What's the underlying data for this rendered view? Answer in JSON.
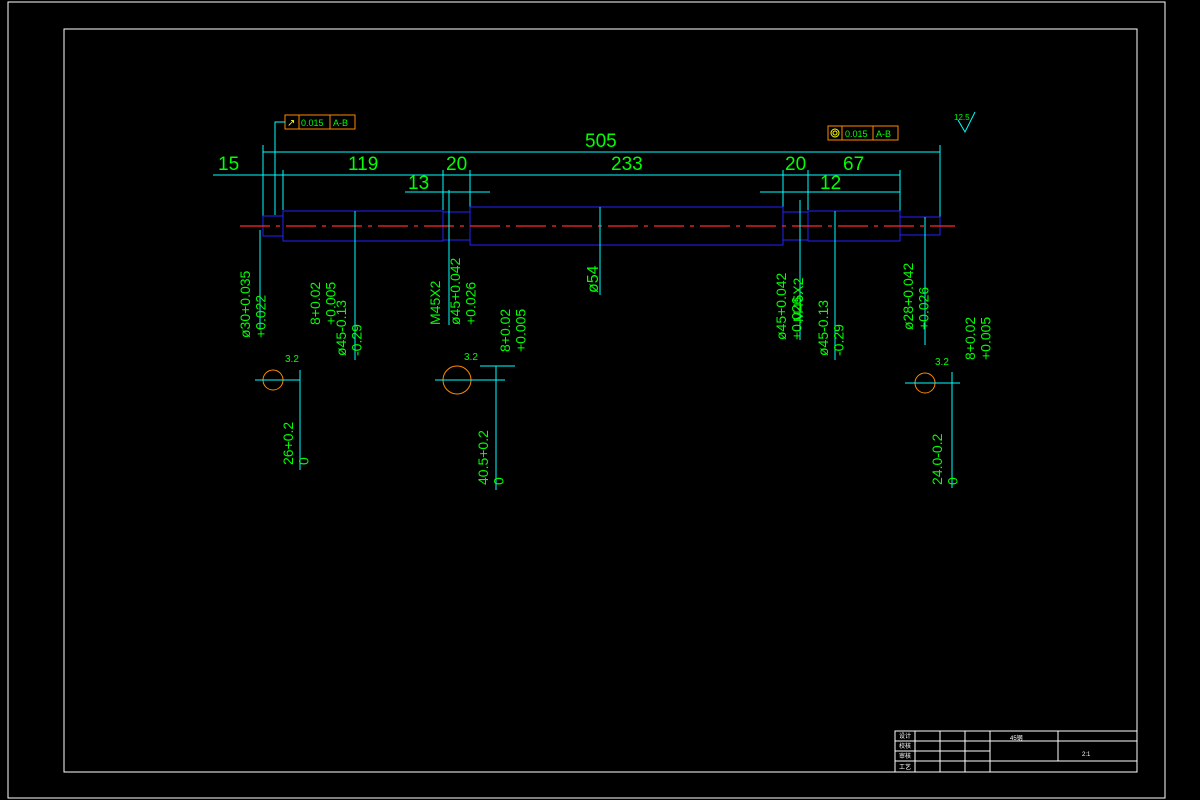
{
  "drawing": {
    "overall_length": "505",
    "segments_top": [
      "15",
      "119",
      "20",
      "233",
      "20",
      "67"
    ],
    "segments_mid": [
      "13",
      "12"
    ],
    "center_dia": "ø54",
    "left_end_dia": "ø30+0.035\n+0.022",
    "left_bearing_dia": "ø45-0.13\n-0.29",
    "left_tol2": "8+0.02\n+0.005",
    "left_thread": "M45X2",
    "left_seat_dia": "ø45+0.042\n+0.026",
    "right_seat_dia": "ø45+0.042\n+0.026",
    "right_thread": "M45X2",
    "right_bearing_dia": "ø45-0.13\n-0.29",
    "right_end_dia": "ø28+0.042\n+0.026",
    "section1_key": "26+0.2\n0",
    "section2_key": "40.5+0.2\n0",
    "section2_width": "8+0.02\n+0.005",
    "section3_key": "24.0-0.2\n0",
    "section3_width": "8+0.02\n+0.005",
    "roughness_main": "12.5",
    "roughness_small": "3.2",
    "fcf_left": {
      "tol": "0.015",
      "datum": "A-B"
    },
    "fcf_right": {
      "tol": "0.015",
      "datum": "A-B"
    }
  },
  "title_block": {
    "material": "45钢",
    "scale": "2:1",
    "label_a": "设计",
    "label_b": "校核",
    "label_c": "审核",
    "label_d": "工艺"
  }
}
